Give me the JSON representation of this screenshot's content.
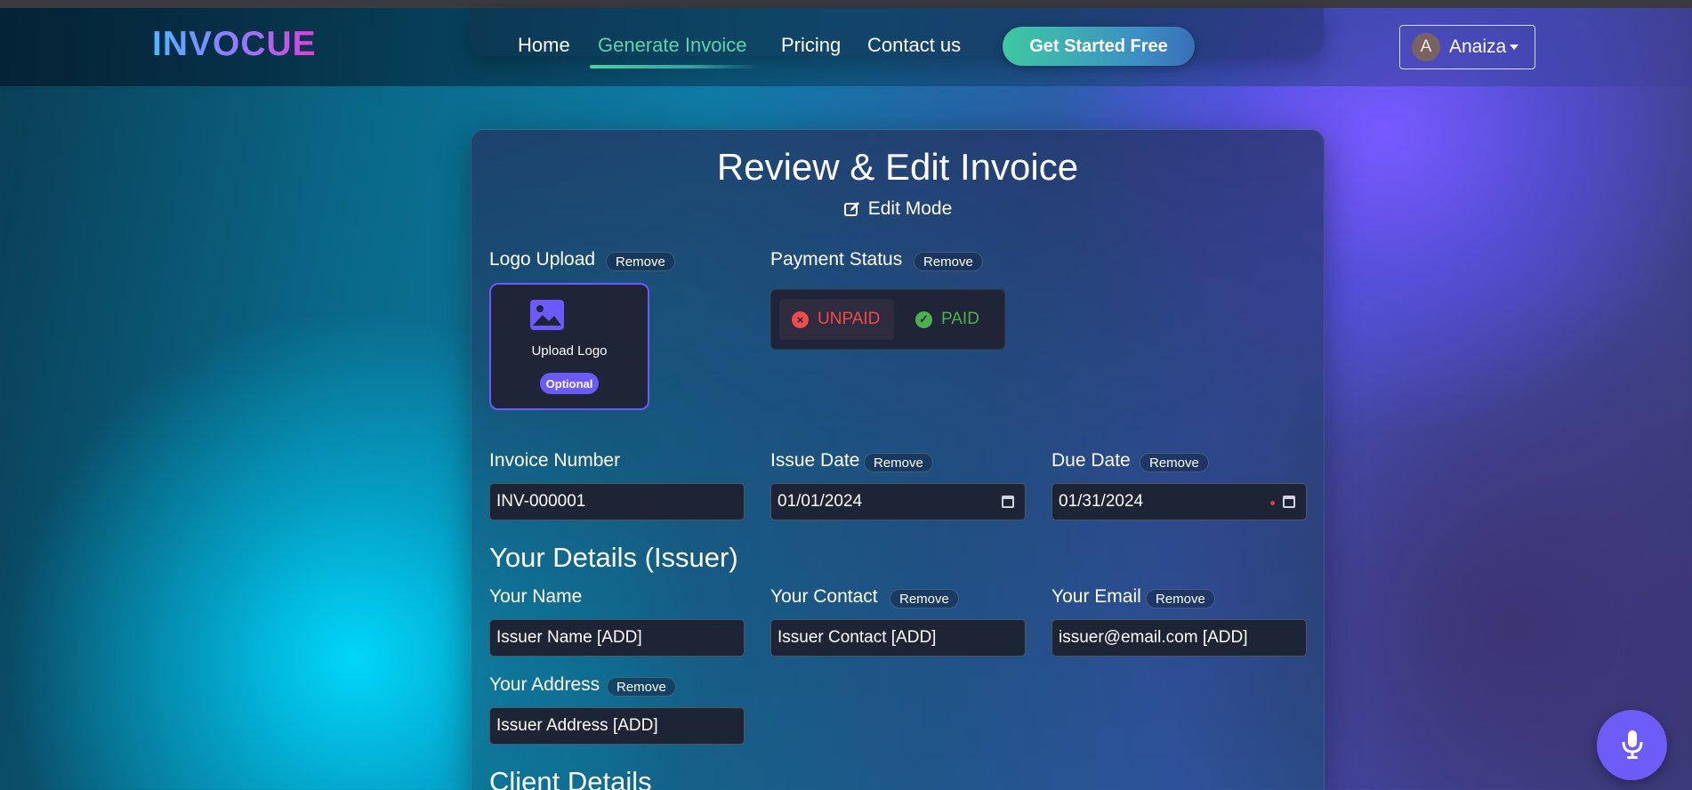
{
  "nav": {
    "brand": "INVOCUE",
    "links": [
      "Home",
      "Generate Invoice",
      "Pricing",
      "Contact us"
    ],
    "active_link": "Generate Invoice",
    "cta": "Get Started Free",
    "user": {
      "avatar_initial": "A",
      "name": "Anaiza"
    }
  },
  "form": {
    "title": "Review & Edit Invoice",
    "mode": "Edit Mode",
    "remove_label": "Remove",
    "logo": {
      "label": "Logo Upload",
      "upload_text": "Upload Logo",
      "badge": "Optional"
    },
    "payment": {
      "label": "Payment Status",
      "unpaid": "UNPAID",
      "paid": "PAID",
      "selected": "UNPAID"
    },
    "invoice_number": {
      "label": "Invoice Number",
      "value": "INV-000001"
    },
    "issue_date": {
      "label": "Issue Date",
      "value": "01/01/2024"
    },
    "due_date": {
      "label": "Due Date",
      "value": "01/31/2024"
    },
    "issuer_heading": "Your Details (Issuer)",
    "issuer": {
      "name_label": "Your Name",
      "name_value": "Issuer Name [ADD]",
      "contact_label": "Your Contact",
      "contact_value": "Issuer Contact [ADD]",
      "email_label": "Your Email",
      "email_value": "issuer@email.com [ADD]",
      "address_label": "Your Address",
      "address_value": "Issuer Address [ADD]"
    },
    "client_heading": "Client Details"
  },
  "colors": {
    "accent": "#6b5bff",
    "active_nav": "#5fd3a8",
    "unpaid": "#f04b4b",
    "paid": "#4caf50"
  },
  "icons": [
    "edit-icon",
    "image-icon",
    "x-circle-icon",
    "check-circle-icon",
    "calendar-icon",
    "microphone-icon",
    "chevron-down-icon"
  ]
}
